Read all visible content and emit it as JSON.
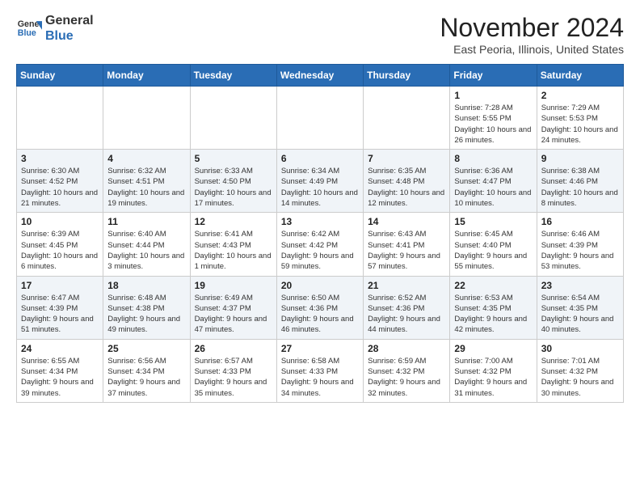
{
  "header": {
    "logo_general": "General",
    "logo_blue": "Blue",
    "title": "November 2024",
    "subtitle": "East Peoria, Illinois, United States"
  },
  "calendar": {
    "days_of_week": [
      "Sunday",
      "Monday",
      "Tuesday",
      "Wednesday",
      "Thursday",
      "Friday",
      "Saturday"
    ],
    "weeks": [
      [
        {
          "day": "",
          "info": ""
        },
        {
          "day": "",
          "info": ""
        },
        {
          "day": "",
          "info": ""
        },
        {
          "day": "",
          "info": ""
        },
        {
          "day": "",
          "info": ""
        },
        {
          "day": "1",
          "info": "Sunrise: 7:28 AM\nSunset: 5:55 PM\nDaylight: 10 hours and 26 minutes."
        },
        {
          "day": "2",
          "info": "Sunrise: 7:29 AM\nSunset: 5:53 PM\nDaylight: 10 hours and 24 minutes."
        }
      ],
      [
        {
          "day": "3",
          "info": "Sunrise: 6:30 AM\nSunset: 4:52 PM\nDaylight: 10 hours and 21 minutes."
        },
        {
          "day": "4",
          "info": "Sunrise: 6:32 AM\nSunset: 4:51 PM\nDaylight: 10 hours and 19 minutes."
        },
        {
          "day": "5",
          "info": "Sunrise: 6:33 AM\nSunset: 4:50 PM\nDaylight: 10 hours and 17 minutes."
        },
        {
          "day": "6",
          "info": "Sunrise: 6:34 AM\nSunset: 4:49 PM\nDaylight: 10 hours and 14 minutes."
        },
        {
          "day": "7",
          "info": "Sunrise: 6:35 AM\nSunset: 4:48 PM\nDaylight: 10 hours and 12 minutes."
        },
        {
          "day": "8",
          "info": "Sunrise: 6:36 AM\nSunset: 4:47 PM\nDaylight: 10 hours and 10 minutes."
        },
        {
          "day": "9",
          "info": "Sunrise: 6:38 AM\nSunset: 4:46 PM\nDaylight: 10 hours and 8 minutes."
        }
      ],
      [
        {
          "day": "10",
          "info": "Sunrise: 6:39 AM\nSunset: 4:45 PM\nDaylight: 10 hours and 6 minutes."
        },
        {
          "day": "11",
          "info": "Sunrise: 6:40 AM\nSunset: 4:44 PM\nDaylight: 10 hours and 3 minutes."
        },
        {
          "day": "12",
          "info": "Sunrise: 6:41 AM\nSunset: 4:43 PM\nDaylight: 10 hours and 1 minute."
        },
        {
          "day": "13",
          "info": "Sunrise: 6:42 AM\nSunset: 4:42 PM\nDaylight: 9 hours and 59 minutes."
        },
        {
          "day": "14",
          "info": "Sunrise: 6:43 AM\nSunset: 4:41 PM\nDaylight: 9 hours and 57 minutes."
        },
        {
          "day": "15",
          "info": "Sunrise: 6:45 AM\nSunset: 4:40 PM\nDaylight: 9 hours and 55 minutes."
        },
        {
          "day": "16",
          "info": "Sunrise: 6:46 AM\nSunset: 4:39 PM\nDaylight: 9 hours and 53 minutes."
        }
      ],
      [
        {
          "day": "17",
          "info": "Sunrise: 6:47 AM\nSunset: 4:39 PM\nDaylight: 9 hours and 51 minutes."
        },
        {
          "day": "18",
          "info": "Sunrise: 6:48 AM\nSunset: 4:38 PM\nDaylight: 9 hours and 49 minutes."
        },
        {
          "day": "19",
          "info": "Sunrise: 6:49 AM\nSunset: 4:37 PM\nDaylight: 9 hours and 47 minutes."
        },
        {
          "day": "20",
          "info": "Sunrise: 6:50 AM\nSunset: 4:36 PM\nDaylight: 9 hours and 46 minutes."
        },
        {
          "day": "21",
          "info": "Sunrise: 6:52 AM\nSunset: 4:36 PM\nDaylight: 9 hours and 44 minutes."
        },
        {
          "day": "22",
          "info": "Sunrise: 6:53 AM\nSunset: 4:35 PM\nDaylight: 9 hours and 42 minutes."
        },
        {
          "day": "23",
          "info": "Sunrise: 6:54 AM\nSunset: 4:35 PM\nDaylight: 9 hours and 40 minutes."
        }
      ],
      [
        {
          "day": "24",
          "info": "Sunrise: 6:55 AM\nSunset: 4:34 PM\nDaylight: 9 hours and 39 minutes."
        },
        {
          "day": "25",
          "info": "Sunrise: 6:56 AM\nSunset: 4:34 PM\nDaylight: 9 hours and 37 minutes."
        },
        {
          "day": "26",
          "info": "Sunrise: 6:57 AM\nSunset: 4:33 PM\nDaylight: 9 hours and 35 minutes."
        },
        {
          "day": "27",
          "info": "Sunrise: 6:58 AM\nSunset: 4:33 PM\nDaylight: 9 hours and 34 minutes."
        },
        {
          "day": "28",
          "info": "Sunrise: 6:59 AM\nSunset: 4:32 PM\nDaylight: 9 hours and 32 minutes."
        },
        {
          "day": "29",
          "info": "Sunrise: 7:00 AM\nSunset: 4:32 PM\nDaylight: 9 hours and 31 minutes."
        },
        {
          "day": "30",
          "info": "Sunrise: 7:01 AM\nSunset: 4:32 PM\nDaylight: 9 hours and 30 minutes."
        }
      ]
    ]
  }
}
